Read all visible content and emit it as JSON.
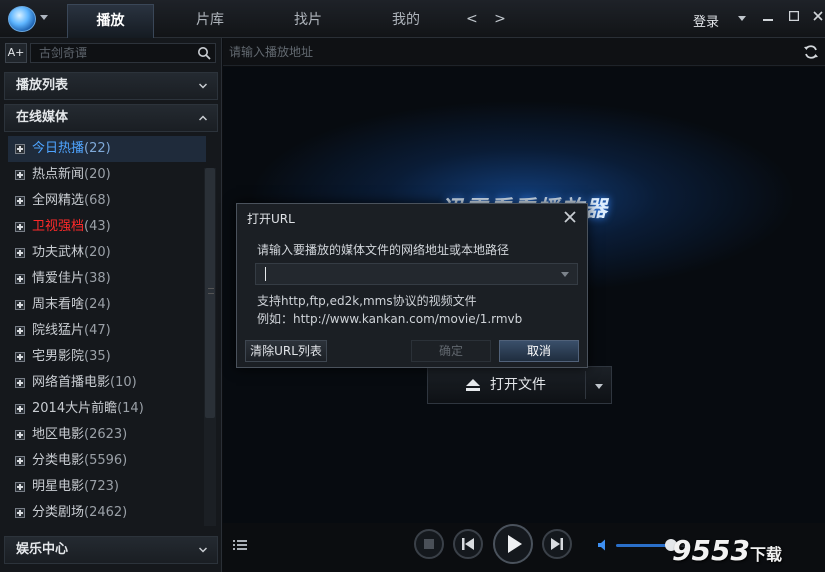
{
  "header": {
    "tabs": [
      {
        "label": "播放",
        "active": true
      },
      {
        "label": "片库",
        "active": false
      },
      {
        "label": "找片",
        "active": false
      },
      {
        "label": "我的",
        "active": false
      }
    ],
    "nav_arrows": "< >",
    "login_label": "登录",
    "window_controls": [
      "menu-caret-icon",
      "minimize-icon",
      "maximize-icon",
      "close-icon"
    ]
  },
  "sidebar": {
    "font_button": "A+",
    "search_placeholder": "古剑奇谭",
    "sections": {
      "playlist": "播放列表",
      "online_media": "在线媒体",
      "entertainment": "娱乐中心"
    },
    "items": [
      {
        "label": "今日热播",
        "count": "(22)",
        "selected": true
      },
      {
        "label": "热点新闻",
        "count": "(20)"
      },
      {
        "label": "全网精选",
        "count": "(68)"
      },
      {
        "label": "卫视强档",
        "count": "(43)",
        "highlight": "#ff2a2a"
      },
      {
        "label": "功夫武林",
        "count": "(20)"
      },
      {
        "label": "情爱佳片",
        "count": "(38)"
      },
      {
        "label": "周末看啥",
        "count": "(24)"
      },
      {
        "label": "院线猛片",
        "count": "(47)"
      },
      {
        "label": "宅男影院",
        "count": "(35)"
      },
      {
        "label": "网络首播电影",
        "count": "(10)"
      },
      {
        "label": "2014大片前瞻",
        "count": "(14)"
      },
      {
        "label": "地区电影",
        "count": "(2623)"
      },
      {
        "label": "分类电影",
        "count": "(5596)"
      },
      {
        "label": "明星电影",
        "count": "(723)"
      },
      {
        "label": "分类剧场",
        "count": "(2462)"
      }
    ]
  },
  "main": {
    "url_placeholder": "请输入播放地址",
    "brand_text": "迅雷看看播放器",
    "open_file_label": "打开文件"
  },
  "dialog": {
    "title": "打开URL",
    "prompt": "请输入要播放的媒体文件的网络地址或本地路径",
    "input_value": "",
    "support_text": "支持http,ftp,ed2k,mms协议的视频文件",
    "example_text": "例如：http://www.kankan.com/movie/1.rmvb",
    "clear_label": "清除URL列表",
    "ok_label": "确定",
    "cancel_label": "取消"
  },
  "player": {
    "volume_level": 0.82
  },
  "watermark": {
    "text": "9553",
    "suffix": "下载"
  },
  "colors": {
    "accent": "#4ea4ff",
    "highlight_red": "#ff2a2a",
    "background": "#0b0d10"
  }
}
